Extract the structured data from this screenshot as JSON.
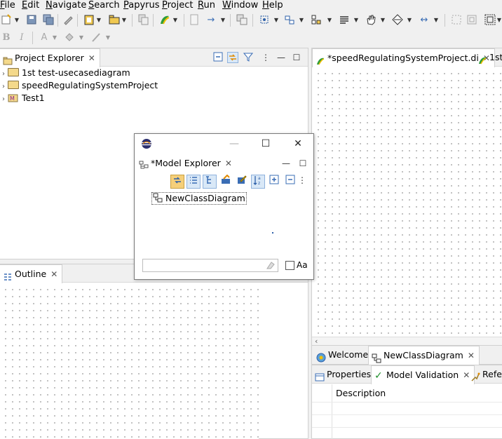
{
  "menubar": {
    "items": [
      {
        "label": "File",
        "u": "F",
        "rest": "ile"
      },
      {
        "label": "Edit",
        "u": "E",
        "rest": "dit"
      },
      {
        "label": "Navigate",
        "u": "N",
        "rest": "avigate"
      },
      {
        "label": "Search",
        "u": "S",
        "rest": "earch"
      },
      {
        "label": "Papyrus",
        "u": "P",
        "rest": "apyrus"
      },
      {
        "label": "Project",
        "u": "P",
        "rest": "roject"
      },
      {
        "label": "Run",
        "u": "R",
        "rest": "un"
      },
      {
        "label": "Window",
        "u": "W",
        "rest": "indow"
      },
      {
        "label": "Help",
        "u": "H",
        "rest": "elp"
      }
    ]
  },
  "text_toolbar": {
    "bold": "B",
    "italic": "I",
    "font": "A"
  },
  "project_explorer": {
    "tab_label": "Project Explorer",
    "items": [
      {
        "label": "1st test-usecasediagram"
      },
      {
        "label": "speedRegulatingSystemProject"
      },
      {
        "label": "Test1"
      }
    ]
  },
  "outline": {
    "tab_label": "Outline"
  },
  "editor": {
    "tabs": [
      {
        "label": "*speedRegulatingSystemProject.di"
      },
      {
        "label": "1st"
      }
    ]
  },
  "lower_tabs": {
    "tabs": [
      {
        "label": "Welcome"
      },
      {
        "label": "NewClassDiagram"
      }
    ]
  },
  "properties": {
    "tabs": [
      {
        "label": "Properties"
      },
      {
        "label": "Model Validation"
      },
      {
        "label": "Refe"
      }
    ],
    "column_header": "Description"
  },
  "model_explorer_dialog": {
    "tab_label": "*Model Explorer",
    "tree_item": "NewClassDiagram",
    "case_label": "Aa",
    "window_buttons": {
      "minimize": "—",
      "maximize": "☐",
      "close": "✕"
    }
  },
  "colors": {
    "accent_tab": "#d9e8f7",
    "toggle_active": "#f5cf7a",
    "validation_check": "#1e8f2b"
  }
}
